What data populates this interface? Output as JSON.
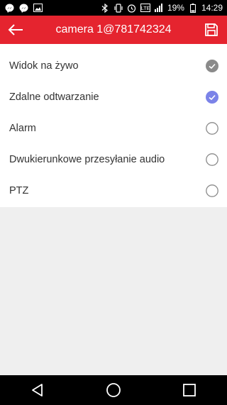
{
  "status_bar": {
    "battery_percent": "19%",
    "time": "14:29",
    "notification_icons": [
      "messenger-icon",
      "messenger-icon",
      "image-icon"
    ],
    "system_icons": [
      "bluetooth-icon",
      "vibrate-icon",
      "alarm-icon",
      "lte-icon",
      "signal-icon",
      "battery-icon"
    ]
  },
  "app_bar": {
    "title": "camera 1@781742324",
    "background": "#e5242f"
  },
  "options": [
    {
      "label": "Widok na żywo",
      "state": "checked-disabled"
    },
    {
      "label": "Zdalne odtwarzanie",
      "state": "checked"
    },
    {
      "label": "Alarm",
      "state": "unchecked"
    },
    {
      "label": "Dwukierunkowe przesyłanie audio",
      "state": "unchecked"
    },
    {
      "label": "PTZ",
      "state": "unchecked"
    }
  ],
  "colors": {
    "checked": "#7b83e8",
    "checked_disabled": "#8a8a8a",
    "unchecked_border": "#8a8a8a"
  },
  "nav_bar": {
    "buttons": [
      "back-triangle-icon",
      "home-circle-icon",
      "recents-square-icon"
    ]
  }
}
